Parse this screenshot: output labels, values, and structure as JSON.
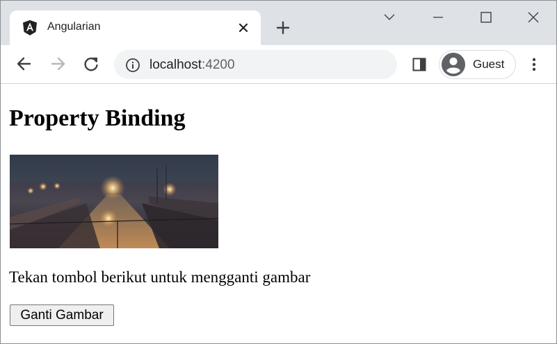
{
  "browser": {
    "tab": {
      "title": "Angularian",
      "favicon": "angular-logo-icon"
    },
    "address_bar": {
      "host": "localhost",
      "port": ":4200"
    },
    "profile": {
      "name": "Guest"
    },
    "icons": [
      "back-icon",
      "forward-icon",
      "reload-icon",
      "info-icon",
      "side-panel-icon",
      "avatar-icon",
      "kebab-menu-icon",
      "new-tab-icon",
      "close-icon",
      "minimize-icon",
      "maximize-icon",
      "chevron-down-icon"
    ]
  },
  "page": {
    "heading": "Property Binding",
    "instruction": "Tekan tombol berikut untuk mengganti gambar",
    "button_label": "Ganti Gambar",
    "image_description": "foggy night railway station"
  },
  "colors": {
    "tabstrip": "#dee1e6",
    "omnibox": "#f1f3f4",
    "angular_logo": "#202124"
  }
}
